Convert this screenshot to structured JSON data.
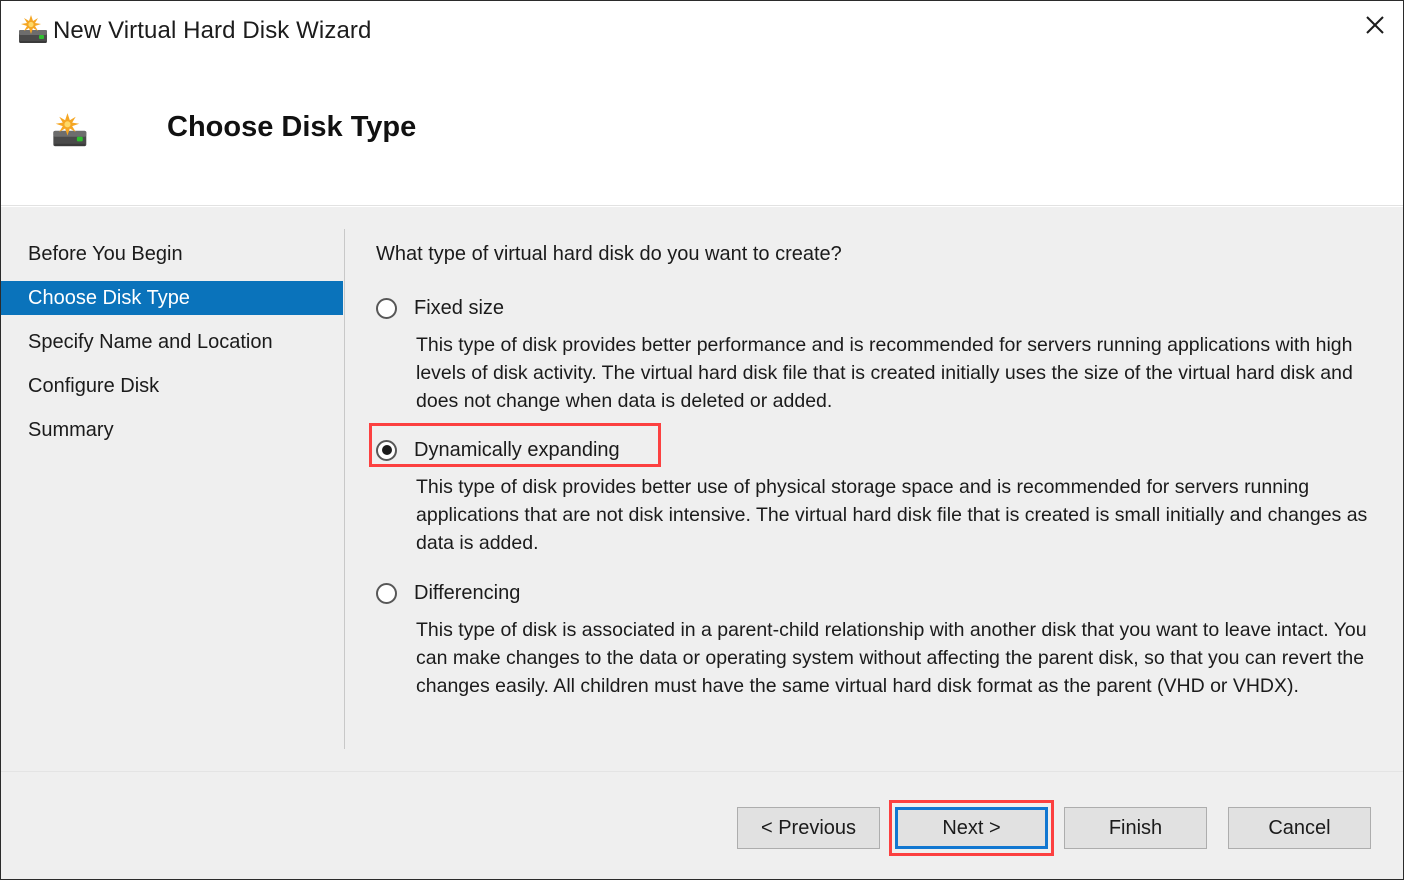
{
  "window": {
    "title": "New Virtual Hard Disk Wizard",
    "title_icon": "virtual-hard-disk-icon",
    "close_label": "✕"
  },
  "header": {
    "title": "Choose Disk Type",
    "icon": "virtual-hard-disk-icon"
  },
  "sidebar": {
    "items": [
      {
        "label": "Before You Begin",
        "selected": false
      },
      {
        "label": "Choose Disk Type",
        "selected": true
      },
      {
        "label": "Specify Name and Location",
        "selected": false
      },
      {
        "label": "Configure Disk",
        "selected": false
      },
      {
        "label": "Summary",
        "selected": false
      }
    ]
  },
  "main": {
    "question": "What type of virtual hard disk do you want to create?",
    "options": [
      {
        "label": "Fixed size",
        "selected": false,
        "description": "This type of disk provides better performance and is recommended for servers running applications with high levels of disk activity. The virtual hard disk file that is created initially uses the size of the virtual hard disk and does not change when data is deleted or added."
      },
      {
        "label": "Dynamically expanding",
        "selected": true,
        "description": "This type of disk provides better use of physical storage space and is recommended for servers running applications that are not disk intensive. The virtual hard disk file that is created is small initially and changes as data is added."
      },
      {
        "label": "Differencing",
        "selected": false,
        "description": "This type of disk is associated in a parent-child relationship with another disk that you want to leave intact. You can make changes to the data or operating system without affecting the parent disk, so that you can revert the changes easily. All children must have the same virtual hard disk format as the parent (VHD or VHDX)."
      }
    ]
  },
  "footer": {
    "previous_label": "< Previous",
    "next_label": "Next >",
    "finish_label": "Finish",
    "cancel_label": "Cancel"
  },
  "annotations": {
    "color": "#fc4040",
    "focus_color": "#1177d1",
    "accent_color": "#0a73bb"
  }
}
